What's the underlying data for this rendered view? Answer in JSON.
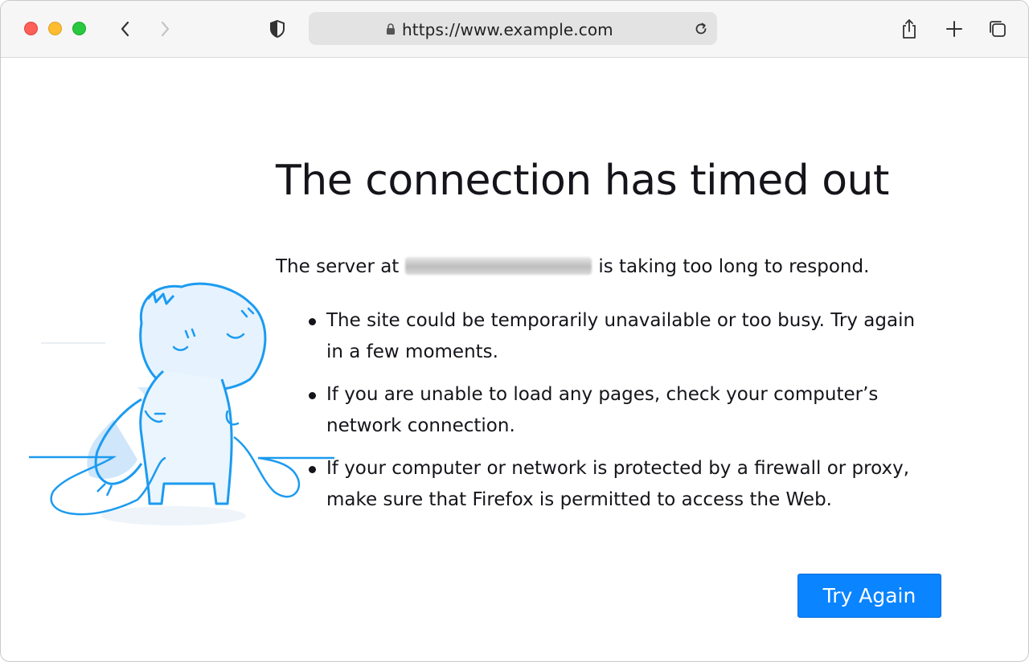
{
  "browser": {
    "url": "https://www.example.com",
    "icons": {
      "back": "chevron-left-icon",
      "forward": "chevron-right-icon",
      "shield": "shield-icon",
      "lock": "lock-icon",
      "reload": "reload-icon",
      "share": "share-icon",
      "new_tab": "plus-icon",
      "tabs": "tabs-overview-icon"
    },
    "traffic_colors": {
      "close": "#fe5f57",
      "minimize": "#febc2e",
      "maximize": "#28c840"
    }
  },
  "error_page": {
    "title": "The connection has timed out",
    "server_prefix": "The server at",
    "server_suffix": "is taking too long to respond.",
    "bullets": [
      "The site could be temporarily unavailable or too busy. Try again in a few moments.",
      "If you are unable to load any pages, check your computer’s network connection.",
      "If your computer or network is protected by a firewall or proxy, make sure that Firefox is permitted to access the Web."
    ],
    "button_label": "Try Again",
    "accent_color": "#0a84ff"
  }
}
